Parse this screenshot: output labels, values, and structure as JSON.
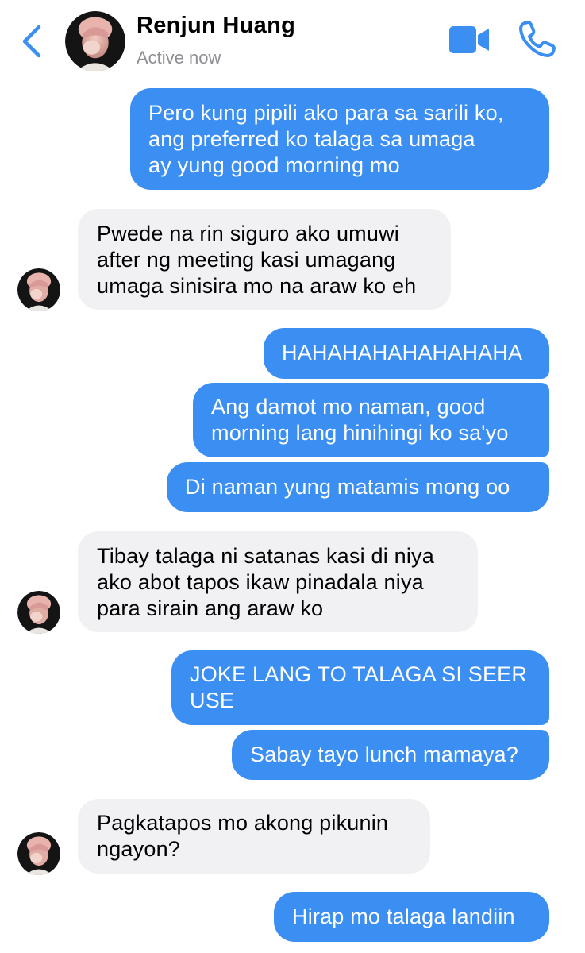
{
  "header": {
    "contact_name": "Renjun Huang",
    "status": "Active now",
    "icons": {
      "back": "chevron-left-icon",
      "video": "video-camera-icon",
      "phone": "phone-icon"
    },
    "accent_color": "#3b8ff3"
  },
  "colors": {
    "sent_bubble": "#3b8ff3",
    "received_bubble": "#f1f1f4",
    "status_text": "#8e8e93"
  },
  "messages": [
    {
      "direction": "sent",
      "lines": [
        "Pero kung pipili ako para sa sarili ko,",
        "ang preferred ko talaga sa umaga",
        "ay yung good morning mo"
      ]
    },
    {
      "direction": "received",
      "lines": [
        "Pwede na rin siguro ako umuwi",
        "after ng meeting kasi umagang",
        "umaga sinisira mo na araw ko eh"
      ]
    },
    {
      "direction": "sent",
      "lines": [
        "HAHAHAHAHAHAHAHA"
      ]
    },
    {
      "direction": "sent",
      "lines": [
        "Ang damot mo naman, good",
        "morning lang hinihingi ko sa'yo"
      ]
    },
    {
      "direction": "sent",
      "lines": [
        "Di naman yung matamis mong oo"
      ]
    },
    {
      "direction": "received",
      "lines": [
        "Tibay talaga ni satanas kasi di niya",
        "ako abot tapos ikaw pinadala niya",
        "para sirain ang araw ko"
      ]
    },
    {
      "direction": "sent",
      "lines": [
        "JOKE LANG TO TALAGA SI SEER",
        "USE"
      ]
    },
    {
      "direction": "sent",
      "lines": [
        "Sabay tayo lunch mamaya?"
      ]
    },
    {
      "direction": "received",
      "lines": [
        "Pagkatapos mo akong pikunin",
        "ngayon?"
      ]
    },
    {
      "direction": "sent",
      "lines": [
        "Hirap mo talaga landiin"
      ]
    }
  ]
}
